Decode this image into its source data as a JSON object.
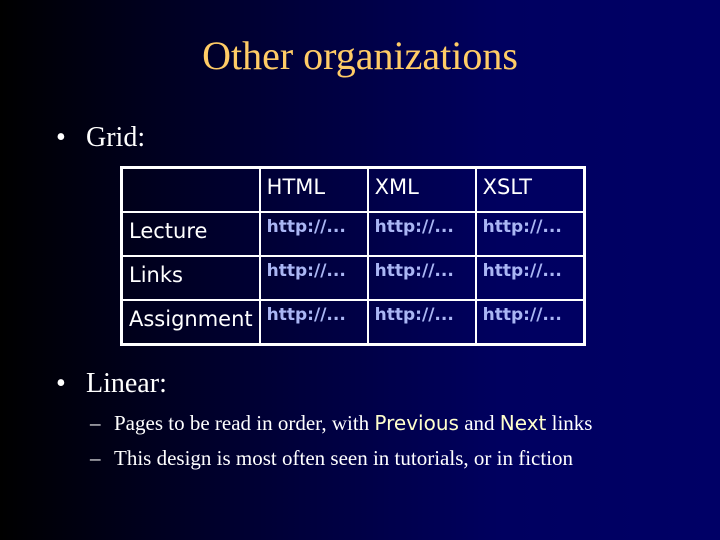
{
  "slide": {
    "title": "Other organizations",
    "title_color": "#ffcc66",
    "background": {
      "from": "#000000",
      "to": "#000066",
      "direction": "left-to-right"
    }
  },
  "bullets": [
    {
      "marker": "•",
      "label": "Grid:"
    },
    {
      "marker": "•",
      "label": "Linear:"
    }
  ],
  "grid_table": {
    "columns": [
      "",
      "HTML",
      "XML",
      "XSLT"
    ],
    "rows": [
      {
        "label": "Lecture",
        "cells": [
          "http://...",
          "http://...",
          "http://..."
        ]
      },
      {
        "label": "Links",
        "cells": [
          "http://...",
          "http://...",
          "http://..."
        ]
      },
      {
        "label": "Assignment",
        "cells": [
          "http://...",
          "http://...",
          "http://..."
        ]
      }
    ],
    "link_color": "#aab6f4"
  },
  "linear_points": [
    {
      "marker": "–",
      "parts": [
        "Pages to be read in order, with ",
        "Previous",
        " and ",
        "Next",
        " links"
      ]
    },
    {
      "marker": "–",
      "text": "This design is most often seen in tutorials, or in fiction"
    }
  ]
}
